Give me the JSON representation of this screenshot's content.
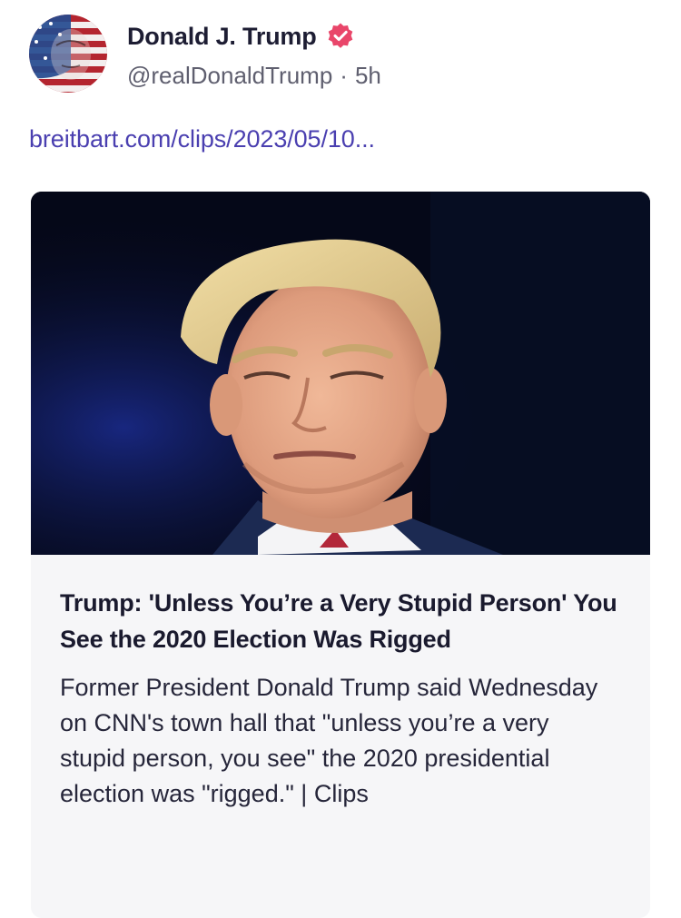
{
  "post": {
    "author": {
      "display_name": "Donald J. Trump",
      "handle": "@realDonaldTrump",
      "verified": true,
      "avatar_icon": "flag-portrait-avatar",
      "badge_color": "#e9466a"
    },
    "meta_separator": "·",
    "timestamp": "5h",
    "link_text": "breitbart.com/clips/2023/05/10...",
    "link_color": "#4a3fb0"
  },
  "preview": {
    "image_alt_icon": "portrait-photo",
    "title": "Trump: 'Unless You’re a Very Stupid Person' You See the 2020 Election Was Rigged",
    "description": "Former President Donald Trump said Wednesday on CNN's town hall that \"unless you’re a very stupid person, you see\" the 2020 presidential election was \"rigged.\" | Clips"
  }
}
